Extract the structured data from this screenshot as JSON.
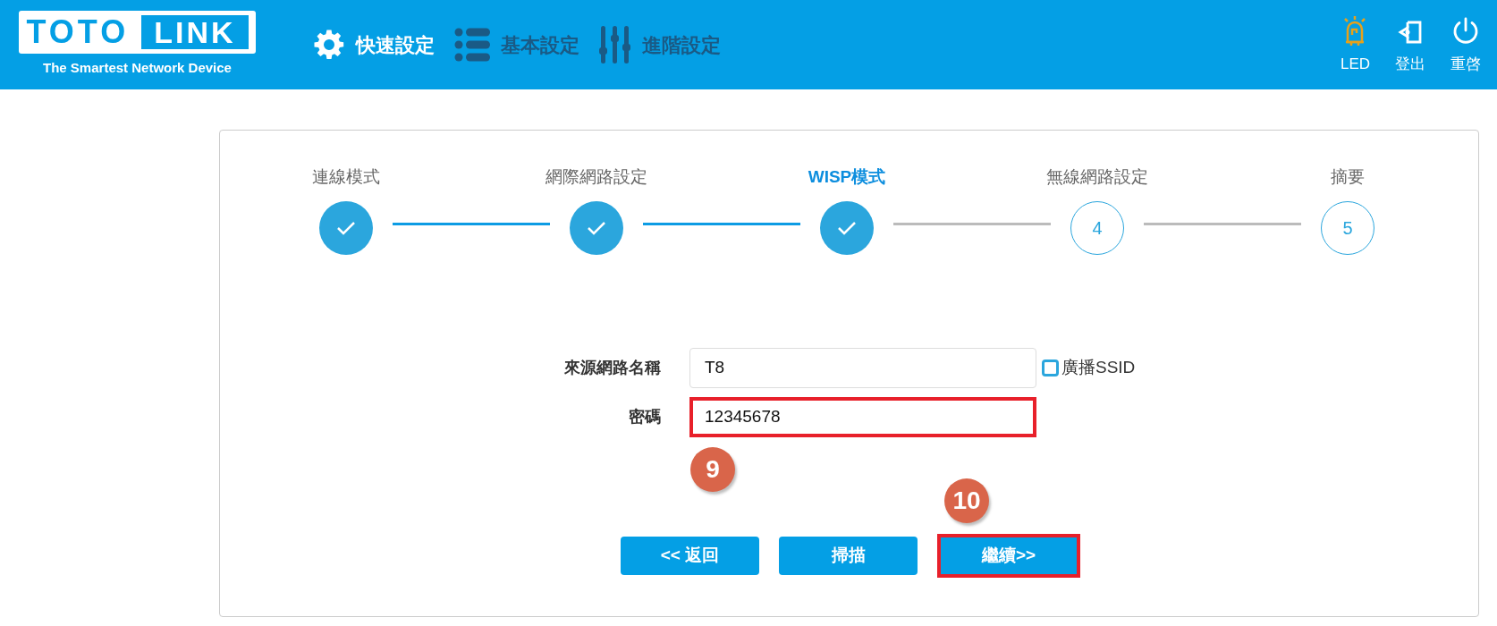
{
  "header": {
    "logo": {
      "part_1": "TOTO",
      "part_2": "LINK",
      "tagline": "The Smartest Network Device"
    },
    "nav": [
      {
        "label": "快速設定",
        "selected": true
      },
      {
        "label": "基本設定",
        "selected": false
      },
      {
        "label": "進階設定",
        "selected": false
      }
    ],
    "actions": [
      {
        "label": "LED"
      },
      {
        "label": "登出"
      },
      {
        "label": "重啓"
      }
    ]
  },
  "steps": [
    {
      "label": "連線模式",
      "done": true,
      "selected": false
    },
    {
      "label": "網際網路設定",
      "done": true,
      "selected": false
    },
    {
      "label": "WISP模式",
      "done": true,
      "selected": true
    },
    {
      "label": "無線網路設定",
      "number": "4",
      "done": false,
      "selected": false
    },
    {
      "label": "摘要",
      "number": "5",
      "done": false,
      "selected": false
    }
  ],
  "form": {
    "fields": [
      {
        "label": "來源網路名稱",
        "value": "T8",
        "highlighted": false,
        "checkbox": {
          "label": "廣播SSID",
          "checked": false
        }
      },
      {
        "label": "密碼",
        "value": "12345678",
        "highlighted": true,
        "marker": "9"
      }
    ]
  },
  "buttons": [
    {
      "label": "<< 返回",
      "highlighted": false
    },
    {
      "label": "掃描",
      "highlighted": false
    },
    {
      "label": "繼續>>",
      "highlighted": true,
      "marker": "10"
    }
  ]
}
